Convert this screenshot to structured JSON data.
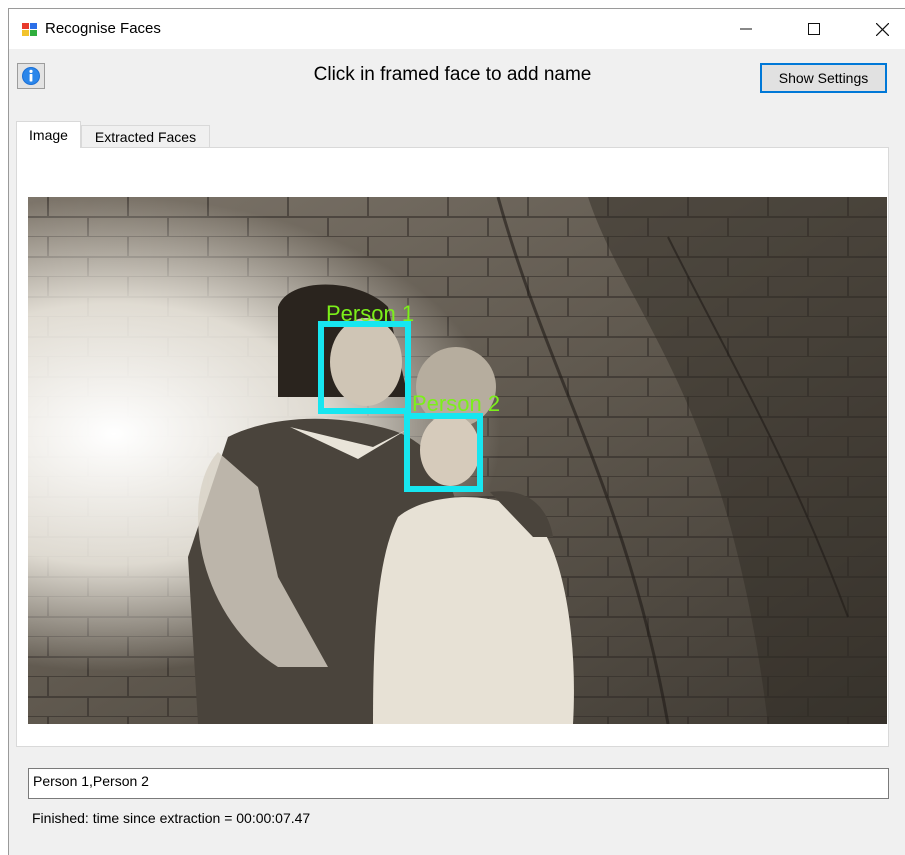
{
  "window": {
    "title": "Recognise Faces"
  },
  "header": {
    "instruction": "Click in framed face to add name",
    "settings_label": "Show Settings"
  },
  "tabs": [
    {
      "label": "Image",
      "selected": true
    },
    {
      "label": "Extracted Faces",
      "selected": false
    }
  ],
  "faces": [
    {
      "label": "Person 1"
    },
    {
      "label": "Person 2"
    }
  ],
  "colors": {
    "face_frame": "#17e6f0",
    "face_label": "#7cf01a",
    "accent": "#0078d7"
  },
  "recognized_names": "Person 1,Person 2",
  "status": "Finished: time since extraction = 00:00:07.47"
}
